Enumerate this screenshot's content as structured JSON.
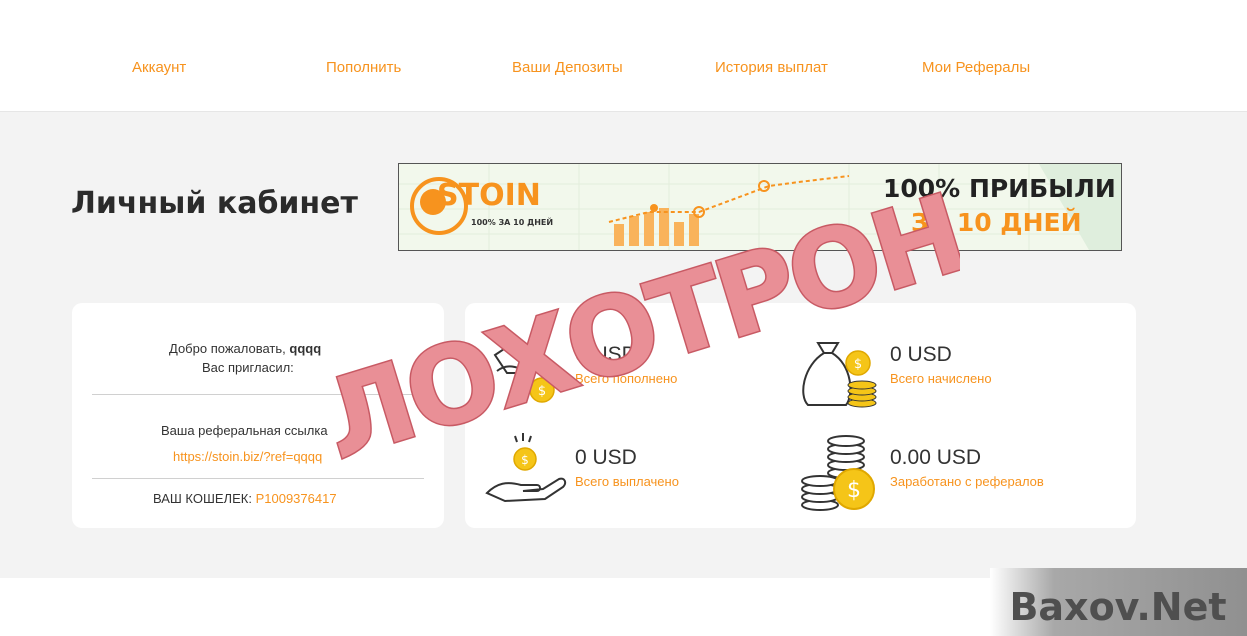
{
  "nav": {
    "items": [
      "Аккаунт",
      "Пополнить",
      "Ваши Депозиты",
      "История выплат",
      "Мои Рефералы"
    ]
  },
  "page": {
    "title": "Личный кабинет"
  },
  "banner": {
    "brand": "STOIN",
    "tagline": "100% ЗА 10 ДНЕЙ",
    "headline_1": "100% ПРИБЫЛИ",
    "headline_2": "ЗА 10 ДНЕЙ"
  },
  "account": {
    "welcome_label": "Добро пожаловать,",
    "username": "qqqq",
    "invited_by_label": "Вас пригласил:",
    "ref_link_label": "Ваша реферальная ссылка",
    "ref_link": "https://stoin.biz/?ref=qqqq",
    "wallet_label": "ВАШ КОШЕЛЕК:",
    "wallet": "P1009376417"
  },
  "stats": [
    {
      "value": "0 USD",
      "label": "Всего пополнено",
      "icon": "hand-coin-icon"
    },
    {
      "value": "0 USD",
      "label": "Всего начислено",
      "icon": "money-bag-icon"
    },
    {
      "value": "0 USD",
      "label": "Всего выплачено",
      "icon": "hand-payout-icon"
    },
    {
      "value": "0.00 USD",
      "label": "Заработано с рефералов",
      "icon": "coin-stack-icon"
    }
  ],
  "overlay": {
    "stamp": "ЛОХОТРОН",
    "watermark": "Baxov.Net"
  },
  "colors": {
    "accent": "#f7931e",
    "stamp": "#e98f96",
    "content_bg": "#f3f3f3",
    "coin": "#f5c518"
  }
}
